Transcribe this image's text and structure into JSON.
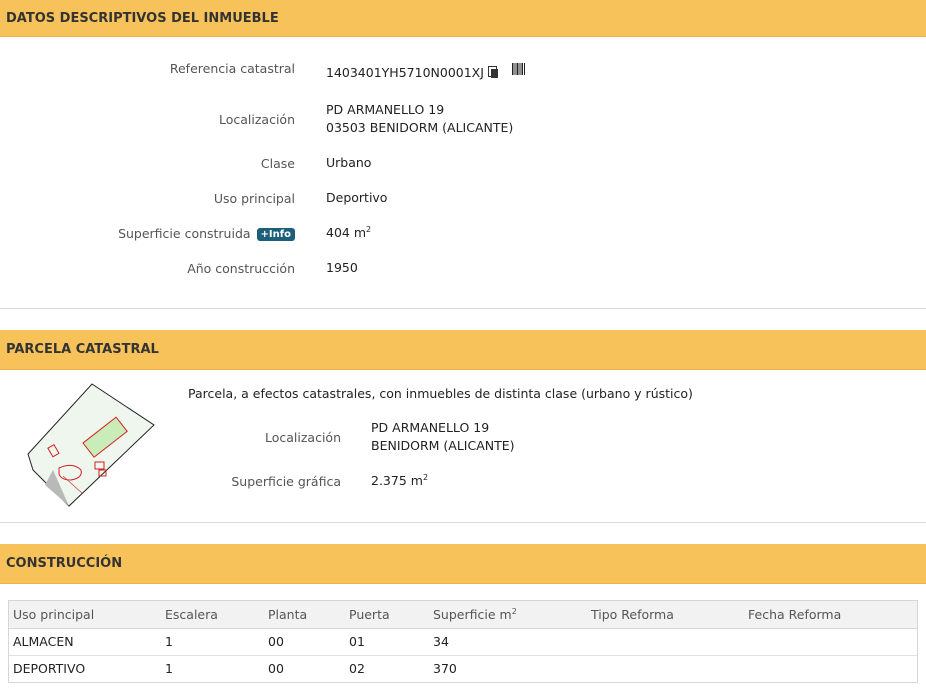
{
  "section1": {
    "title": "DATOS DESCRIPTIVOS DEL INMUEBLE",
    "ref_label": "Referencia catastral",
    "ref_value": "1403401YH5710N0001XJ",
    "loc_label": "Localización",
    "loc_line1": "PD ARMANELLO 19",
    "loc_line2": "03503 BENIDORM (ALICANTE)",
    "clase_label": "Clase",
    "clase_value": "Urbano",
    "uso_label": "Uso principal",
    "uso_value": "Deportivo",
    "sup_label": "Superficie construida",
    "info_badge": "+Info",
    "sup_value": "404 m",
    "sup_unit_sup": "2",
    "anio_label": "Año construcción",
    "anio_value": "1950"
  },
  "section2": {
    "title": "PARCELA CATASTRAL",
    "description": "Parcela, a efectos catastrales, con inmuebles de distinta clase (urbano y rústico)",
    "loc_label": "Localización",
    "loc_line1": "PD ARMANELLO 19",
    "loc_line2": "BENIDORM (ALICANTE)",
    "sup_label": "Superficie gráfica",
    "sup_value": "2.375 m",
    "sup_unit_sup": "2"
  },
  "section3": {
    "title": "CONSTRUCCIÓN",
    "headers": [
      "Uso principal",
      "Escalera",
      "Planta",
      "Puerta",
      "Superficie m",
      "Tipo Reforma",
      "Fecha Reforma"
    ],
    "header_sup": "2",
    "rows": [
      [
        "ALMACEN",
        "1",
        "00",
        "01",
        "34",
        "",
        ""
      ],
      [
        "DEPORTIVO",
        "1",
        "00",
        "02",
        "370",
        "",
        ""
      ]
    ]
  },
  "colors": {
    "header_bg": "#f8c25a",
    "info_badge": "#1c5f7a",
    "parcel_fill": "#eef6ee",
    "building_fill": "#c9ecb8",
    "building_outline": "#d42020"
  },
  "icons": [
    "copy-icon",
    "barcode-icon",
    "parcel-map"
  ]
}
